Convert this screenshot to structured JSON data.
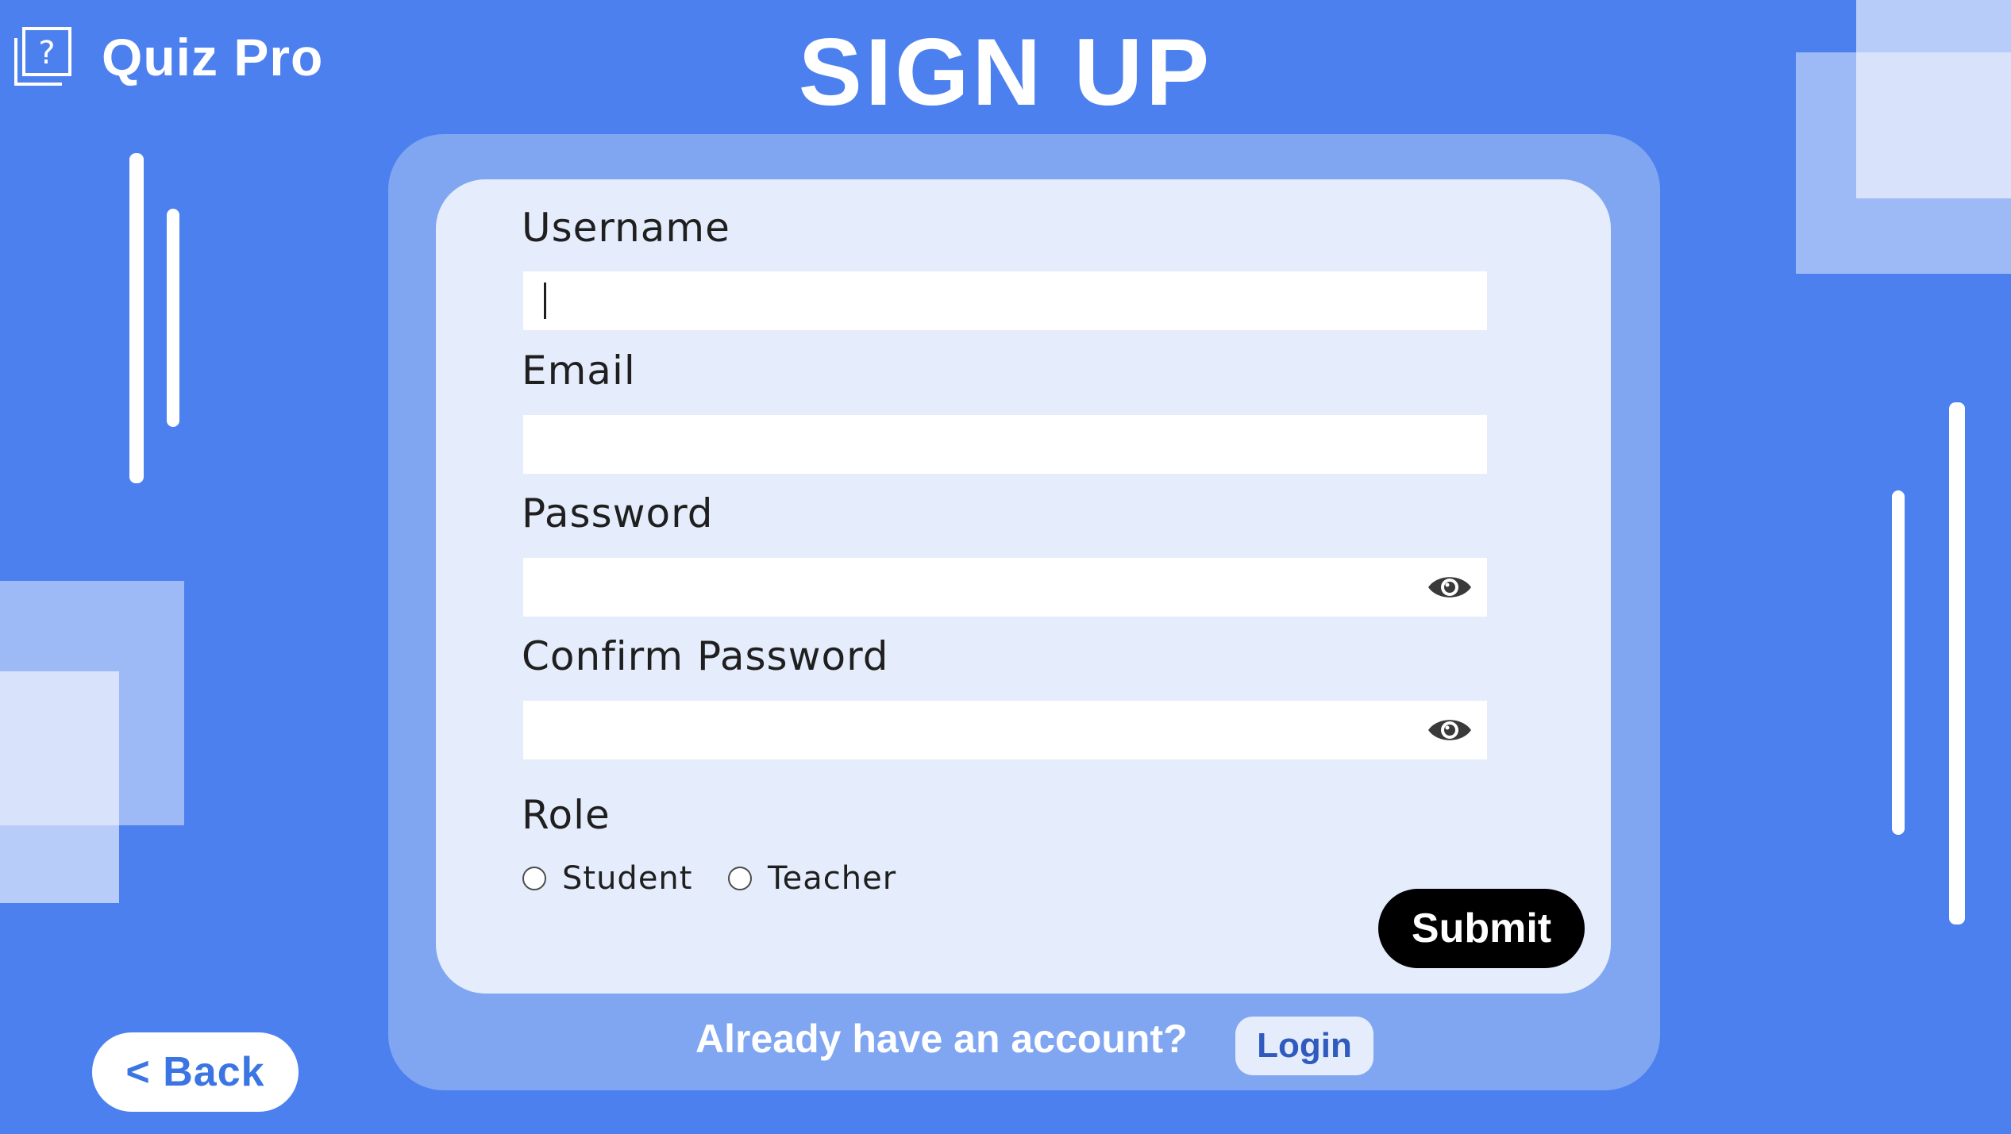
{
  "brand": {
    "name": "Quiz Pro",
    "icon": "quiz-question-icon"
  },
  "page": {
    "title": "SIGN UP"
  },
  "form": {
    "username": {
      "label": "Username",
      "value": ""
    },
    "email": {
      "label": "Email",
      "value": ""
    },
    "password": {
      "label": "Password",
      "value": "",
      "toggle_icon": "eye-icon"
    },
    "confirm_password": {
      "label": "Confirm Password",
      "value": "",
      "toggle_icon": "eye-icon"
    },
    "role": {
      "label": "Role",
      "options": [
        {
          "label": "Student",
          "selected": false
        },
        {
          "label": "Teacher",
          "selected": false
        }
      ]
    },
    "submit_label": "Submit"
  },
  "footer": {
    "prompt": "Already have an account?",
    "login_label": "Login"
  },
  "nav": {
    "back_label": "< Back"
  },
  "colors": {
    "background": "#4d80ef",
    "panel": "#80a6f2",
    "card": "#e5ecfb",
    "submit": "#000000",
    "accent_text": "#3b75e3"
  }
}
